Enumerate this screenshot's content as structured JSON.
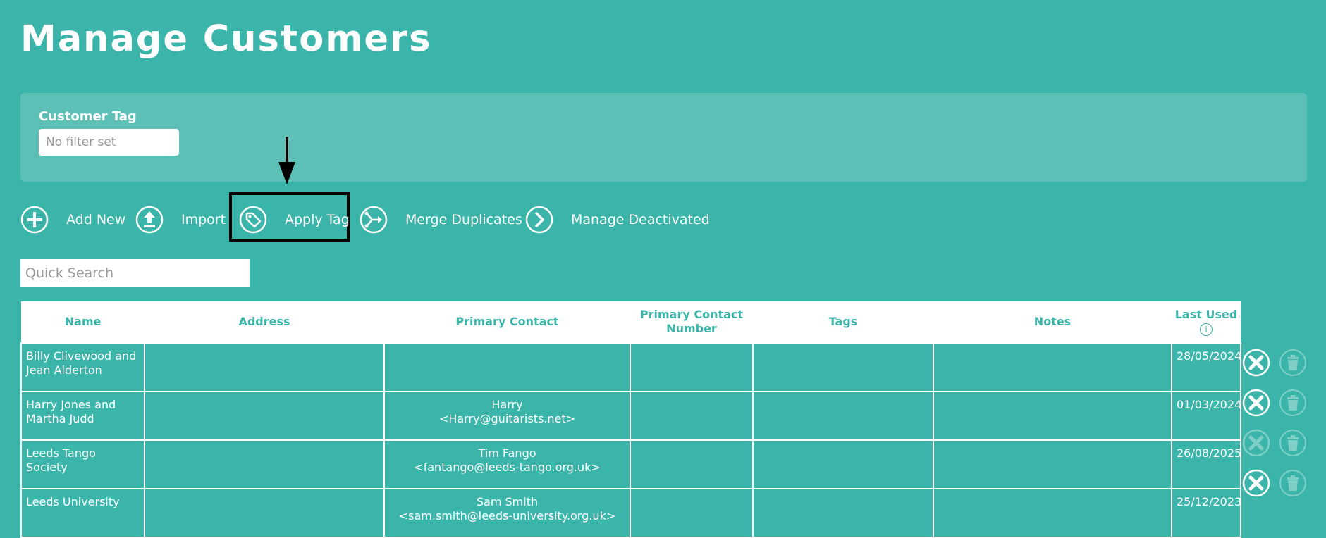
{
  "page": {
    "title": "Manage Customers"
  },
  "filter": {
    "label": "Customer Tag",
    "placeholder": "No filter set"
  },
  "toolbar": {
    "add_new": "Add New",
    "import": "Import",
    "apply_tag": "Apply Tag",
    "merge_duplicates": "Merge Duplicates",
    "manage_deactivated": "Manage Deactivated"
  },
  "search": {
    "placeholder": "Quick Search"
  },
  "table": {
    "headers": {
      "name": "Name",
      "address": "Address",
      "primary_contact": "Primary Contact",
      "primary_contact_number_1": "Primary Contact",
      "primary_contact_number_2": "Number",
      "tags": "Tags",
      "notes": "Notes",
      "last_used": "Last Used",
      "info": "i"
    },
    "rows": [
      {
        "name": "Billy Clivewood and Jean Alderton",
        "address": "",
        "contact_name": "",
        "contact_email": "",
        "number": "",
        "tags": "",
        "notes": "",
        "last_used": "28/05/2024",
        "deactivate_enabled": true
      },
      {
        "name": "Harry Jones and Martha Judd",
        "address": "",
        "contact_name": "Harry",
        "contact_email": "<Harry@guitarists.net>",
        "number": "",
        "tags": "",
        "notes": "",
        "last_used": "01/03/2024",
        "deactivate_enabled": true
      },
      {
        "name": "Leeds Tango Society",
        "address": "",
        "contact_name": "Tim Fango",
        "contact_email": "<fantango@leeds-tango.org.uk>",
        "number": "",
        "tags": "",
        "notes": "",
        "last_used": "26/08/2025",
        "deactivate_enabled": false
      },
      {
        "name": "Leeds University",
        "address": "",
        "contact_name": "Sam Smith",
        "contact_email": "<sam.smith@leeds-university.org.uk>",
        "number": "",
        "tags": "",
        "notes": "",
        "last_used": "25/12/2023",
        "deactivate_enabled": true
      }
    ]
  },
  "colors": {
    "background": "#3bb5aa",
    "panel": "#5cc0b6",
    "highlight": "#000000"
  }
}
